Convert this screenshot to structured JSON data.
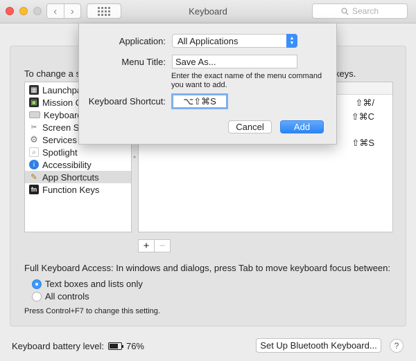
{
  "window": {
    "title": "Keyboard",
    "search_placeholder": "Search"
  },
  "main": {
    "intro_text": "To change a sh",
    "intro_tail": "keys.",
    "categories": [
      {
        "label": "Launchpa",
        "icon": "launchpad-icon"
      },
      {
        "label": "Mission C",
        "icon": "mission-control-icon"
      },
      {
        "label": "Keyboard",
        "icon": "keyboard-icon"
      },
      {
        "label": "Screen Sh",
        "icon": "screenshot-icon"
      },
      {
        "label": "Services",
        "icon": "gear-icon"
      },
      {
        "label": "Spotlight",
        "icon": "spotlight-icon"
      },
      {
        "label": "Accessibility",
        "icon": "accessibility-icon"
      },
      {
        "label": "App Shortcuts",
        "icon": "app-shortcuts-icon",
        "selected": true
      },
      {
        "label": "Function Keys",
        "icon": "fn-icon"
      }
    ],
    "shortcuts": [
      "⇧⌘/",
      "⇧⌘C",
      "⇧⌘S"
    ],
    "add_label": "+",
    "remove_label": "−",
    "full_keyboard_access": "Full Keyboard Access: In windows and dialogs, press Tab to move keyboard focus between:",
    "radio_options": [
      {
        "label": "Text boxes and lists only",
        "selected": true
      },
      {
        "label": "All controls",
        "selected": false
      }
    ],
    "hint": "Press Control+F7 to change this setting."
  },
  "footer": {
    "battery_label": "Keyboard battery level:",
    "battery_percent": "76%",
    "battery_level": 0.76,
    "bluetooth_button": "Set Up Bluetooth Keyboard...",
    "help_label": "?"
  },
  "sheet": {
    "application_label": "Application:",
    "application_value": "All Applications",
    "menu_title_label": "Menu Title:",
    "menu_title_value": "Save As...",
    "note": "Enter the exact name of the menu command you want to add.",
    "shortcut_label": "Keyboard Shortcut:",
    "shortcut_value": "⌥⇧⌘S",
    "cancel_label": "Cancel",
    "add_label": "Add"
  },
  "colors": {
    "accent": "#3b99fc",
    "close": "#fc5f57",
    "minimize": "#fdbc2e"
  }
}
